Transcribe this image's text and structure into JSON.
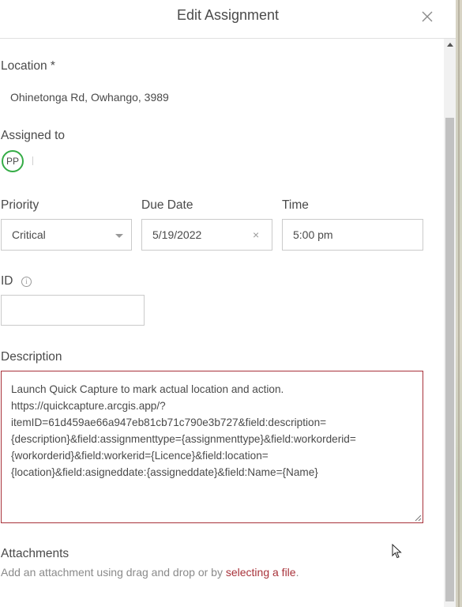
{
  "dialog": {
    "title": "Edit Assignment"
  },
  "location": {
    "label": "Location *",
    "value": "Ohinetonga Rd, Owhango, 3989"
  },
  "assigned_to": {
    "label": "Assigned to",
    "initials": "PP"
  },
  "priority": {
    "label": "Priority",
    "value": "Critical"
  },
  "due_date": {
    "label": "Due Date",
    "value": "5/19/2022",
    "clear_glyph": "×"
  },
  "time": {
    "label": "Time",
    "value": "5:00 pm"
  },
  "id_field": {
    "label": "ID",
    "value": "",
    "info_glyph": "i"
  },
  "description": {
    "label": "Description",
    "value": "Launch Quick Capture to mark actual location and action.\nhttps://quickcapture.arcgis.app/?\nitemID=61d459ae66a947eb81cb71c790e3b727&field:description=\n{description}&field:assignmenttype={assignmenttype}&field:workorderid=\n{workorderid}&field:workerid={Licence}&field:location=\n{location}&field:asigneddate:{assigneddate}&field:Name={Name}"
  },
  "attachments": {
    "label": "Attachments",
    "prefix": "Add an attachment using drag and drop or by ",
    "link": "selecting a file",
    "suffix": "."
  },
  "colors": {
    "accent": "#a8323a",
    "avatar_ring": "#35ac46"
  }
}
